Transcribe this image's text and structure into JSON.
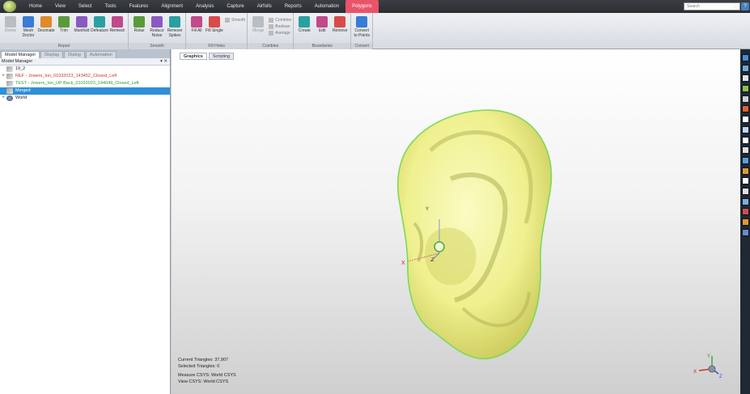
{
  "menubar": {
    "items": [
      "Home",
      "View",
      "Select",
      "Tools",
      "Features",
      "Alignment",
      "Analysis",
      "Capture",
      "Airfoils",
      "Reports",
      "Automation",
      "Polygons"
    ],
    "active_index": 11,
    "search_placeholder": "Search",
    "help_label": "?"
  },
  "ribbon": {
    "groups": [
      {
        "label": "Repair",
        "tools": [
          {
            "label": "Delete",
            "icon": "delete-x-icon",
            "disabled": true
          },
          {
            "label": "Mesh Doctor",
            "icon": "mesh-doctor-icon"
          },
          {
            "label": "Decimate",
            "icon": "decimate-icon"
          },
          {
            "label": "Trim",
            "icon": "trim-icon"
          },
          {
            "label": "Manifold",
            "icon": "manifold-icon"
          },
          {
            "label": "Defeature",
            "icon": "defeature-icon"
          },
          {
            "label": "Remesh",
            "icon": "remesh-icon"
          }
        ]
      },
      {
        "label": "Smooth",
        "tools": [
          {
            "label": "Relax",
            "icon": "relax-icon"
          },
          {
            "label": "Reduce Noise",
            "icon": "reduce-noise-icon"
          },
          {
            "label": "Remove Spikes",
            "icon": "remove-spikes-icon"
          }
        ]
      },
      {
        "label": "Fill Holes",
        "tools": [
          {
            "label": "Fill All",
            "icon": "fill-all-icon"
          },
          {
            "label": "Fill Single",
            "icon": "fill-single-icon"
          }
        ],
        "extras": [
          "Smooth"
        ]
      },
      {
        "label": "Combine",
        "tools": [
          {
            "label": "Merge",
            "icon": "merge-icon",
            "disabled": true
          }
        ],
        "extras": [
          "Combine",
          "Boolean",
          "Average"
        ]
      },
      {
        "label": "Boundaries",
        "tools": [
          {
            "label": "Create",
            "icon": "create-boundary-icon"
          },
          {
            "label": "Edit",
            "icon": "edit-boundary-icon"
          },
          {
            "label": "Remove",
            "icon": "remove-boundary-icon"
          }
        ]
      },
      {
        "label": "Convert",
        "tools": [
          {
            "label": "Convert to Points",
            "icon": "convert-to-points-icon"
          }
        ]
      }
    ]
  },
  "left_panel": {
    "tabs": [
      "Model Manager",
      "Display",
      "Dialog",
      "Automation"
    ],
    "active_tab": 0,
    "header_title": "Model Manager",
    "header_controls": "▾ ✕",
    "tree": [
      {
        "label": "19_2",
        "expander": "",
        "color": "#222222",
        "icon": "mesh-node-icon"
      },
      {
        "label": "REF - Jowers_Ion_01032023_143452_Closed_Left",
        "expander": "+",
        "color": "#c0392b",
        "icon": "mesh-node-icon"
      },
      {
        "label": "TEST - Jowers_Ion_UP Back_01032023_144049_Closed_Left",
        "expander": "",
        "color": "#2e9a3a",
        "icon": "mesh-node-icon"
      },
      {
        "label": "Merged",
        "expander": "",
        "color": "#ffffff",
        "icon": "mesh-node-icon",
        "selected": true
      },
      {
        "label": "World",
        "expander": "+",
        "color": "#222222",
        "icon": "world-globe-icon"
      }
    ]
  },
  "viewport": {
    "tabs": [
      "Graphics",
      "Scripting"
    ],
    "active_tab": 0,
    "axis_labels": {
      "x": "X",
      "y": "Y",
      "z": "Z"
    },
    "status": {
      "current_triangles": "Current Triangles: 37,907",
      "selected_triangles": "Selected Triangles: 0",
      "measure_csys": "Measure CSYS: World CSYS",
      "view_csys": "View CSYS: World CSYS"
    },
    "colors": {
      "mesh": "#f1f296",
      "mesh_edge": "#7ed957",
      "selection": "#2f8fd8"
    }
  },
  "right_toolbar": {
    "buttons": [
      "view-front-icon",
      "view-iso-icon",
      "view-top-icon",
      "view-fit-icon",
      "zoom-icon",
      "rotate-icon",
      "pan-icon",
      "shade-icon",
      "wireframe-icon",
      "points-icon",
      "boundary-icon",
      "render-icon",
      "lighting-icon",
      "section-icon",
      "clip-icon",
      "measure-icon",
      "display-icon",
      "color-icon"
    ]
  }
}
